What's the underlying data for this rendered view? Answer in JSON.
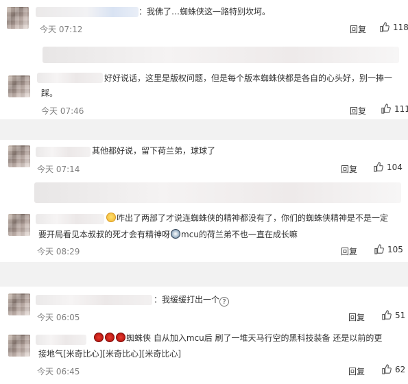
{
  "comments": [
    {
      "text": "：我佛了…蜘蛛侠这一路特别坎坷。",
      "time": "今天 07:12",
      "reply": "回复",
      "likes": "118"
    },
    {
      "text": "好好说话，这里是版权问题，但是每个版本蜘蛛侠都是各自的心头好，别一捧一踩。",
      "text_line1": "好好说话，这里是版权问题，但是每个版本蜘蛛侠都是各自的心头好，别一捧一",
      "text_line2": "踩。",
      "time": "今天 07:46",
      "reply": "回复",
      "likes": "111"
    },
    {
      "text": "其他都好说，留下荷兰弟，球球了",
      "time": "今天 07:14",
      "reply": "回复",
      "likes": "104"
    },
    {
      "text_line1": "咋出了两部了才说连蜘蛛侠的精神都没有了，你们的蜘蛛侠精神是不是一定",
      "text_line2a": "要开局看见本叔叔的死才会有精神呀",
      "text_line2b": "mcu的荷兰弟不也一直在成长嘛",
      "time": "今天 08:29",
      "reply": "回复",
      "likes": "105"
    },
    {
      "text": "：我缓缓打出一个",
      "time": "今天 06:05",
      "reply": "回复",
      "likes": "51"
    },
    {
      "text_line1": "蜘蛛侠 自从加入mcu后 刷了一堆天马行空的黑科技装备 还是以前的更",
      "text_line2": "接地气[米奇比心][米奇比心][米奇比心]",
      "time": "今天 06:45",
      "reply": "回复",
      "likes": "62"
    }
  ],
  "icons": {
    "like": "thumbs-up-icon",
    "smile": "smile-emoji-icon",
    "spider": "spider-emoji-icon",
    "question": "question-icon",
    "orb": "crystal-ball-emoji-icon"
  },
  "colors": {
    "background": "#ffffff",
    "separator": "#f2f2f2",
    "time": "#808080",
    "text": "#333333"
  }
}
